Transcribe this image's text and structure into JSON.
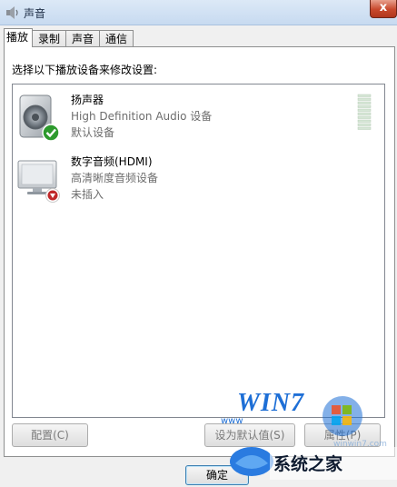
{
  "window": {
    "title": "声音",
    "close_label": "x"
  },
  "tabs": [
    {
      "label": "播放",
      "active": true
    },
    {
      "label": "录制",
      "active": false
    },
    {
      "label": "声音",
      "active": false
    },
    {
      "label": "通信",
      "active": false
    }
  ],
  "instruction": "选择以下播放设备来修改设置:",
  "devices": [
    {
      "name": "扬声器",
      "description": "High Definition Audio 设备",
      "status": "默认设备",
      "icon": "speaker-icon",
      "badge": "green-check-badge"
    },
    {
      "name": "数字音频(HDMI)",
      "description": "高清晰度音频设备",
      "status": "未插入",
      "icon": "monitor-icon",
      "badge": "red-down-arrow-badge"
    }
  ],
  "buttons": {
    "configure": "配置(C)",
    "set_default": "设为默认值(S)",
    "properties": "属性(P)",
    "ok": "确定"
  },
  "watermark": {
    "logo_text": "WIN7",
    "site_text": "系统之家",
    "url_fragment": "www",
    "url_fragment2": "winwin7.com"
  },
  "colors": {
    "accent": "#3c7fb1",
    "check_green": "#2d9a2d",
    "arrow_red": "#c0282a",
    "watermark_blue": "#1e6fd6"
  }
}
